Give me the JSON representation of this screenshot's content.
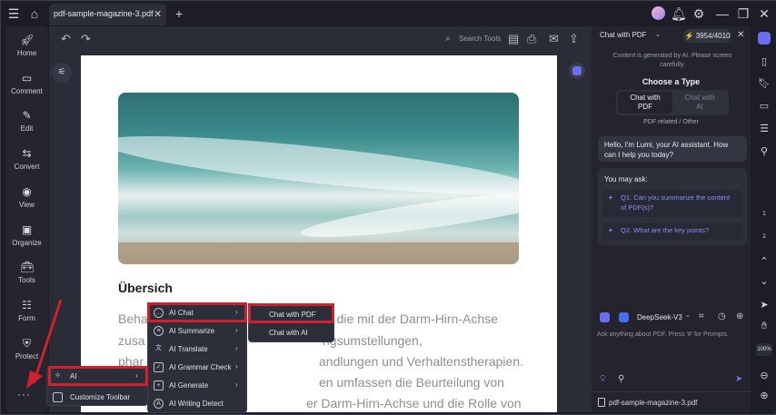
{
  "tab": {
    "title": "pdf-sample-magazine-3.pdf"
  },
  "left_nav": [
    {
      "label": "Home",
      "icon": "rocket-icon"
    },
    {
      "label": "Comment",
      "icon": "comment-icon"
    },
    {
      "label": "Edit",
      "icon": "edit-icon"
    },
    {
      "label": "Convert",
      "icon": "convert-icon"
    },
    {
      "label": "View",
      "icon": "eye-icon"
    },
    {
      "label": "Organize",
      "icon": "organize-icon"
    },
    {
      "label": "Tools",
      "icon": "toolbox-icon"
    },
    {
      "label": "Form",
      "icon": "form-icon"
    },
    {
      "label": "Protect",
      "icon": "shield-icon"
    }
  ],
  "toolbar": {
    "search_label": "Search Tools"
  },
  "document": {
    "heading": "Übersich",
    "lines": [
      "Beha",
      "n, die mit der Darm-Hirn-Achse",
      "zusa",
      "ngsumstellungen,",
      "phar",
      "andlungen und Verhaltenstherapien.",
      "en umfassen die Beurteilung von",
      "er Darm-Hirn-Achse und die Rolle von"
    ]
  },
  "menus": {
    "more": [
      {
        "label": "AI",
        "icon": "ai-wand-icon"
      },
      {
        "label": "Customize Toolbar",
        "icon": "customize-toolbar-icon"
      }
    ],
    "ai": [
      {
        "label": "AI Chat",
        "icon": "ai-chat-icon"
      },
      {
        "label": "AI Summarize",
        "icon": "ai-summarize-icon"
      },
      {
        "label": "AI Translate",
        "icon": "ai-translate-icon"
      },
      {
        "label": "AI Grammar Check",
        "icon": "ai-grammar-icon"
      },
      {
        "label": "AI Generate",
        "icon": "ai-generate-icon"
      },
      {
        "label": "AI Writing Detect",
        "icon": "ai-detect-icon"
      }
    ],
    "ai_chat": [
      {
        "label": "Chat with PDF"
      },
      {
        "label": "Chat with AI"
      }
    ]
  },
  "chat_panel": {
    "mode": "Chat with PDF",
    "credits": "3954/4010",
    "notice": "Content is generated by AI. Please screen carefully.",
    "choose_type": "Choose a Type",
    "type_pdf_line1": "Chat with",
    "type_pdf_line2": "PDF",
    "type_ai_line1": "Chat with",
    "type_ai_line2": "AI",
    "type_sub": "PDF related / Other",
    "greeting": "Hello, I'm Lumi, your AI assistant. How can I help you today?",
    "ask_title": "You may ask:",
    "q1": "Q1. Can you summarize the content of PDF(s)?",
    "q2": "Q2. What are the key points?",
    "model": "DeepSeek-V3",
    "input_placeholder": "Ask anything about PDF. Press '#' for Prompts.",
    "file": "pdf-sample-magazine-3.pdf"
  },
  "right_rail": {
    "page_current": "1",
    "page_total": "1",
    "zoom": "100%"
  },
  "colors": {
    "highlight": "#d21f2e",
    "accent": "#6e72f5",
    "bg": "#1c1d26"
  }
}
